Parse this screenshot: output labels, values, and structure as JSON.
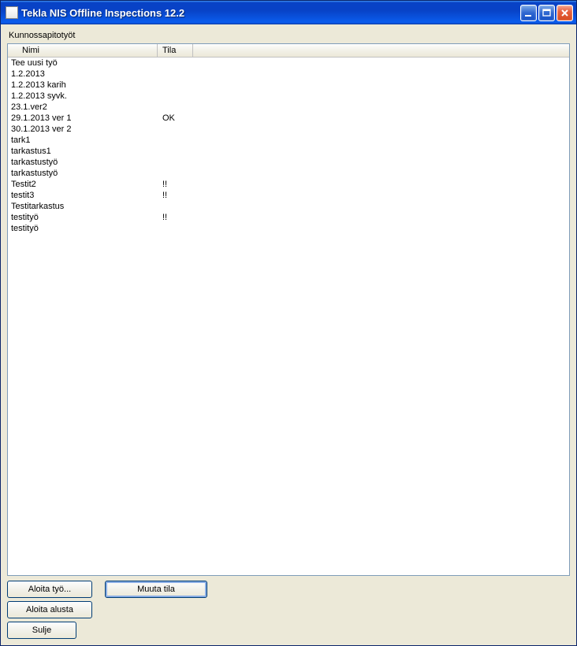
{
  "window": {
    "title": "Tekla NIS Offline Inspections 12.2"
  },
  "section_label": "Kunnossapitotyöt",
  "columns": {
    "nimi": "Nimi",
    "tila": "Tila"
  },
  "rows": [
    {
      "nimi": "Tee uusi työ",
      "tila": ""
    },
    {
      "nimi": "1.2.2013",
      "tila": ""
    },
    {
      "nimi": "1.2.2013 karih",
      "tila": ""
    },
    {
      "nimi": "1.2.2013 syvk.",
      "tila": ""
    },
    {
      "nimi": "23.1.ver2",
      "tila": ""
    },
    {
      "nimi": "29.1.2013 ver 1",
      "tila": "OK"
    },
    {
      "nimi": "30.1.2013 ver 2",
      "tila": ""
    },
    {
      "nimi": "tark1",
      "tila": ""
    },
    {
      "nimi": "tarkastus1",
      "tila": ""
    },
    {
      "nimi": "tarkastustyö",
      "tila": ""
    },
    {
      "nimi": "tarkastustyö",
      "tila": ""
    },
    {
      "nimi": "Testit2",
      "tila": "!!"
    },
    {
      "nimi": "testit3",
      "tila": "!!"
    },
    {
      "nimi": "Testitarkastus",
      "tila": ""
    },
    {
      "nimi": "testityö",
      "tila": "!!"
    },
    {
      "nimi": "testityö",
      "tila": ""
    }
  ],
  "buttons": {
    "aloita_tyo": "Aloita työ...",
    "muuta_tila": "Muuta tila",
    "aloita_alusta": "Aloita alusta",
    "sulje": "Sulje"
  }
}
